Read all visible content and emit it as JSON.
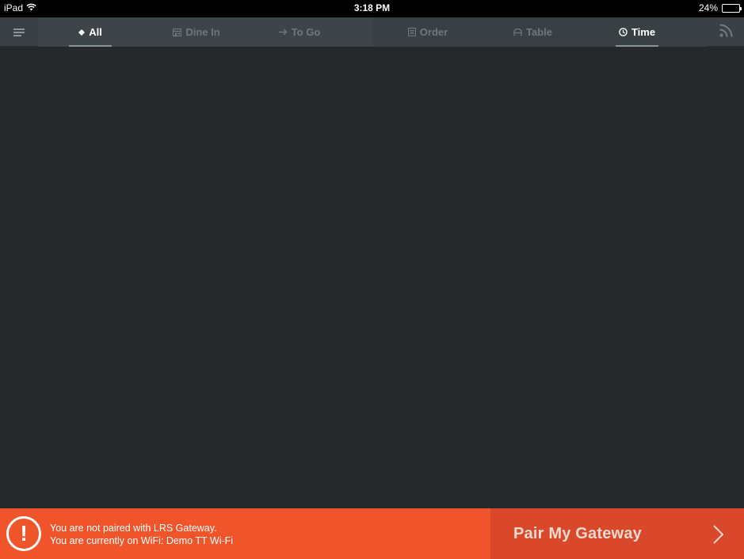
{
  "status_bar": {
    "device": "iPad",
    "time": "3:18 PM",
    "battery": "24%",
    "battery_level": 0.24
  },
  "nav": {
    "menu_icon": "hamburger-menu-icon",
    "feed_icon": "rss-feed-icon",
    "filter_tabs": [
      {
        "label": "All",
        "icon": "diamond-icon",
        "active": true
      },
      {
        "label": "Dine In",
        "icon": "storefront-icon",
        "active": false
      },
      {
        "label": "To Go",
        "icon": "arrow-right-icon",
        "active": false
      }
    ],
    "sort_tabs": [
      {
        "label": "Order",
        "icon": "receipt-icon",
        "active": false
      },
      {
        "label": "Table",
        "icon": "table-icon",
        "active": false
      },
      {
        "label": "Time",
        "icon": "clock-icon",
        "active": true
      }
    ]
  },
  "banner": {
    "alert_icon": "exclamation-circle-icon",
    "alert_symbol": "!",
    "line1": "You are not paired with LRS Gateway.",
    "line2": "You are currently on WiFi: Demo TT Wi-Fi",
    "button_label": "Pair My Gateway",
    "button_icon": "chevron-right-icon"
  },
  "colors": {
    "background": "#25292c",
    "navbar": "#3a4044",
    "active_tab": "#ffffff",
    "inactive_tab": "#6f787d",
    "banner": "#f0542a",
    "banner_button": "#d9482a"
  }
}
